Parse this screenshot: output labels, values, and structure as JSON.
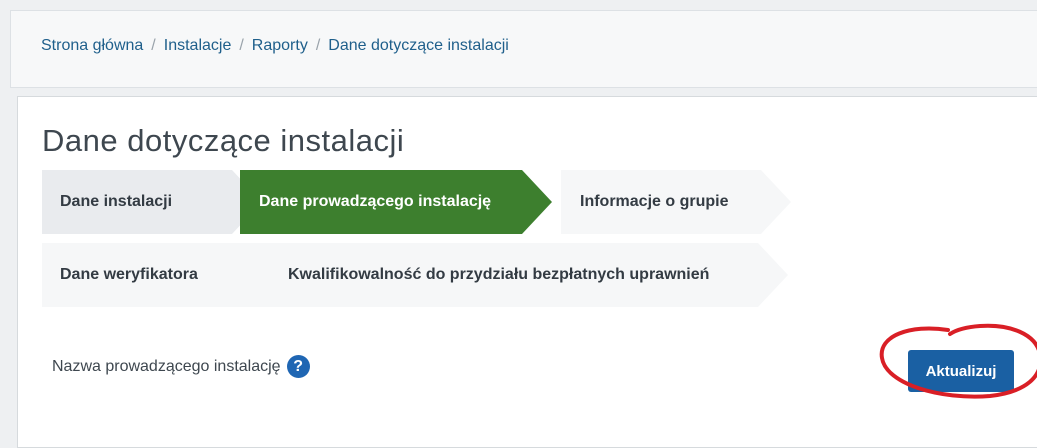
{
  "breadcrumb": {
    "items": [
      "Strona główna",
      "Instalacje",
      "Raporty",
      "Dane dotyczące instalacji"
    ]
  },
  "page": {
    "title": "Dane dotyczące instalacji"
  },
  "steps": {
    "dane_instalacji": "Dane instalacji",
    "dane_prowadzacego": "Dane prowadzącego instalację",
    "informacje_o_grupie": "Informacje o grupie",
    "dane_weryfikatora": "Dane weryfikatora",
    "kwalifikowalnosc": "Kwalifikowalność do przydziału bezpłatnych uprawnień"
  },
  "form": {
    "operator_name_label": "Nazwa prowadzącego instalację",
    "help_icon": "question-circle-icon",
    "help_glyph": "?",
    "update_button": "Aktualizuj"
  },
  "colors": {
    "active_step": "#3d7f2e",
    "primary_button": "#1a60a3",
    "link": "#1f5f8b",
    "annotation": "#d91f26"
  }
}
